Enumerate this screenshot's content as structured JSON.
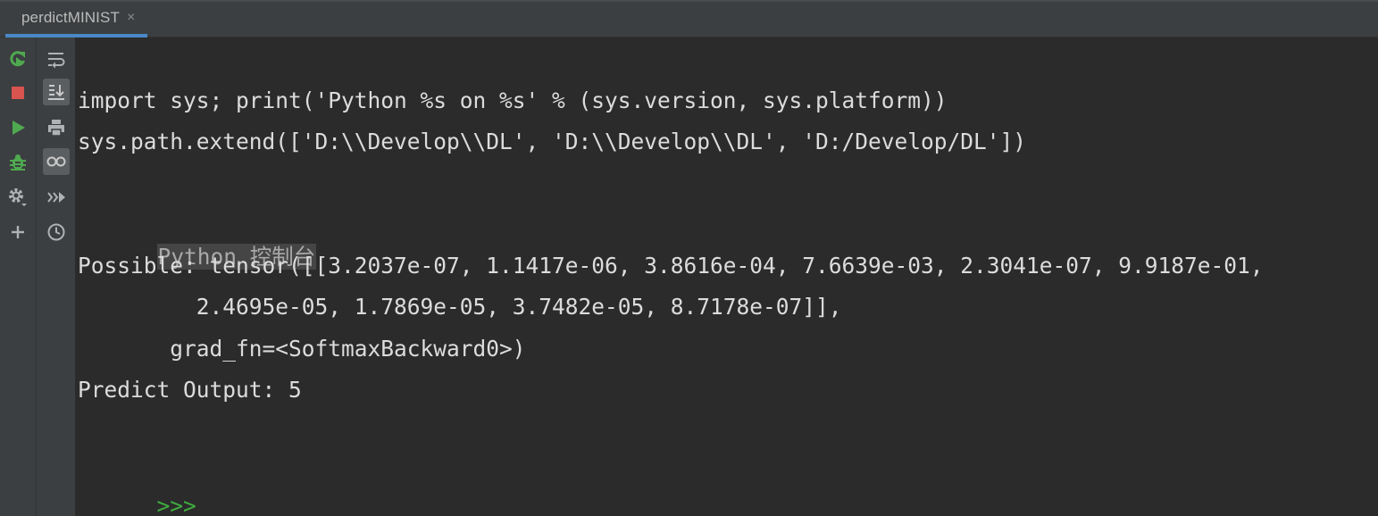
{
  "tab": {
    "title": "perdictMINIST",
    "close_glyph": "×"
  },
  "left_toolbar": [
    {
      "name": "rerun-icon",
      "color": "#4fa94f"
    },
    {
      "name": "stop-icon",
      "color": "#d9534f"
    },
    {
      "name": "run-icon",
      "color": "#4fa94f"
    },
    {
      "name": "debug-icon",
      "color": "#4fa94f"
    },
    {
      "name": "settings-icon",
      "color": "#afb1b3"
    },
    {
      "name": "add-icon",
      "color": "#afb1b3"
    }
  ],
  "second_toolbar": [
    {
      "name": "soft-wrap-icon"
    },
    {
      "name": "scroll-to-end-icon",
      "active": true
    },
    {
      "name": "print-icon"
    },
    {
      "name": "show-variables-icon",
      "active": true
    },
    {
      "name": "execute-icon"
    },
    {
      "name": "history-icon"
    }
  ],
  "console": {
    "lines": [
      "import sys; print('Python %s on %s' % (sys.version, sys.platform))",
      "sys.path.extend(['D:\\\\Develop\\\\DL', 'D:\\\\Develop\\\\DL', 'D:/Develop/DL'])",
      "Python 控制台",
      "Possible: tensor([[3.2037e-07, 1.1417e-06, 3.8616e-04, 7.6639e-03, 2.3041e-07, 9.9187e-01,",
      "         2.4695e-05, 1.7869e-05, 3.7482e-05, 8.7178e-07]],",
      "       grad_fn=<SoftmaxBackward0>)",
      "Predict Output: 5"
    ],
    "prompt": ">>>"
  },
  "colors": {
    "background": "#2b2b2b",
    "text": "#dcdcdc",
    "prompt": "#3fad3f",
    "tab_underline": "#4a88c7"
  }
}
